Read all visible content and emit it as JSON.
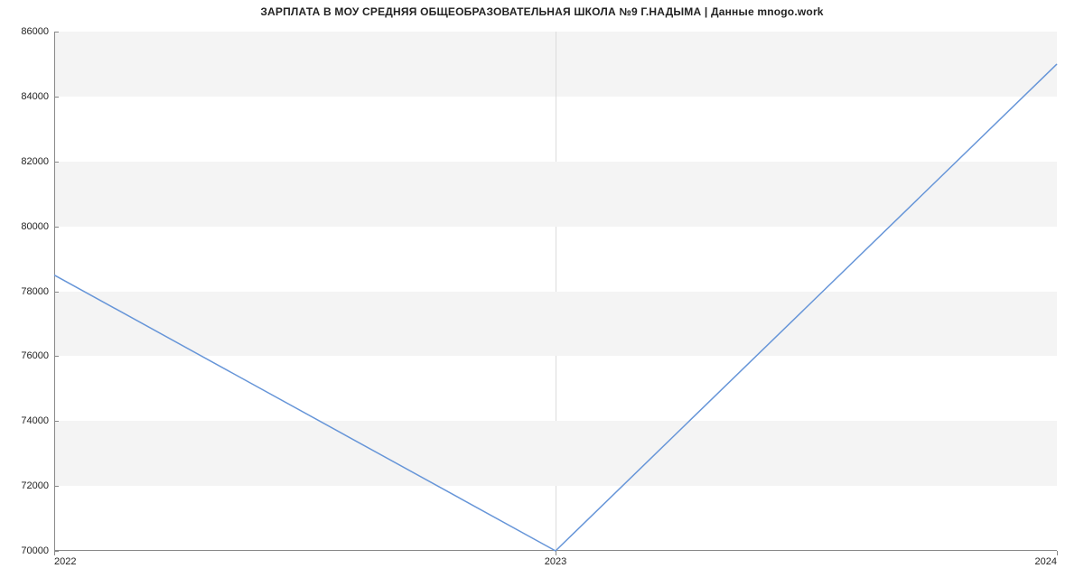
{
  "chart_data": {
    "type": "line",
    "title": "ЗАРПЛАТА В МОУ СРЕДНЯЯ ОБЩЕОБРАЗОВАТЕЛЬНАЯ ШКОЛА №9 Г.НАДЫМА | Данные mnogo.work",
    "xlabel": "",
    "ylabel": "",
    "x": [
      2022,
      2023,
      2024
    ],
    "values": [
      78500,
      70000,
      85000
    ],
    "x_tick_labels": [
      "2022",
      "2023",
      "2024"
    ],
    "y_tick_labels": [
      "70000",
      "72000",
      "74000",
      "76000",
      "78000",
      "80000",
      "82000",
      "84000",
      "86000"
    ],
    "ylim": [
      70000,
      86000
    ],
    "xlim": [
      2022,
      2024
    ],
    "line_color": "#6695d8",
    "grid": {
      "x": true,
      "y_bands": true
    }
  }
}
